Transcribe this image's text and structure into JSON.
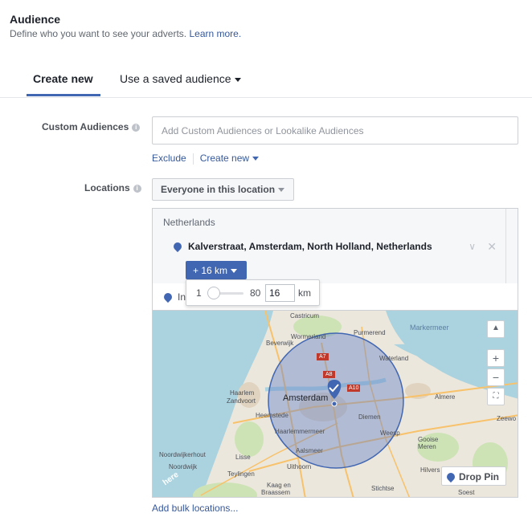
{
  "header": {
    "title": "Audience",
    "subtitle": "Define who you want to see your adverts.",
    "learn_more": "Learn more."
  },
  "tabs": {
    "create_new": "Create new",
    "saved_audience": "Use a saved audience"
  },
  "custom_audiences": {
    "label": "Custom Audiences",
    "placeholder": "Add Custom Audiences or Lookalike Audiences",
    "exclude": "Exclude",
    "create_new": "Create new"
  },
  "locations": {
    "label": "Locations",
    "selector": "Everyone in this location",
    "country": "Netherlands",
    "location": "Kalverstraat, Amsterdam, North Holland, Netherlands",
    "radius_button": "+ 16 km",
    "include_text": "In",
    "slider": {
      "min": "1",
      "max": "80",
      "value": "16",
      "unit": "km",
      "fraction": 0.19
    },
    "add_bulk": "Add bulk locations..."
  },
  "map": {
    "drop_pin": "Drop Pin",
    "labels": {
      "castricum": "Castricum",
      "beverwijk": "Beverwijk",
      "wormerland": "Wormerland",
      "purmerend": "Purmerend",
      "markermeer": "Markermeer",
      "waterland": "Waterland",
      "haarlem": "Haarlem",
      "zandvoort": "Zandvoort",
      "amsterdam": "Amsterdam",
      "almere": "Almere",
      "heemstede": "Heemstede",
      "diemen": "Diemen",
      "zeewolde": "Zeewo",
      "haarlemmermeer": "Haarlemmermeer",
      "weesp": "Weesp",
      "gooise": "Gooise",
      "meren": "Meren",
      "noordwijkerhout": "Noordwijkerhout",
      "lisse": "Lisse",
      "aalsmeer": "Aalsmeer",
      "noordwijk": "Noordwijk",
      "uithoorn": "Uithoorn",
      "hilversum": "Hilvers",
      "teylingen": "Teylingen",
      "kaag": "Kaag en",
      "braassem": "Braassem",
      "stichtse": "Stichtse",
      "soest": "Soest",
      "here": "here",
      "a7": "A7",
      "a8": "A8",
      "a10": "A10"
    },
    "controls": {
      "up": "▲",
      "plus": "+",
      "minus": "−",
      "fit": "⛶"
    }
  },
  "icons": {
    "info": "i",
    "close": "✕",
    "chevron": "∨"
  },
  "colors": {
    "accent": "#4267b2",
    "link": "#365899",
    "radius_fill": "#6b86c7"
  }
}
